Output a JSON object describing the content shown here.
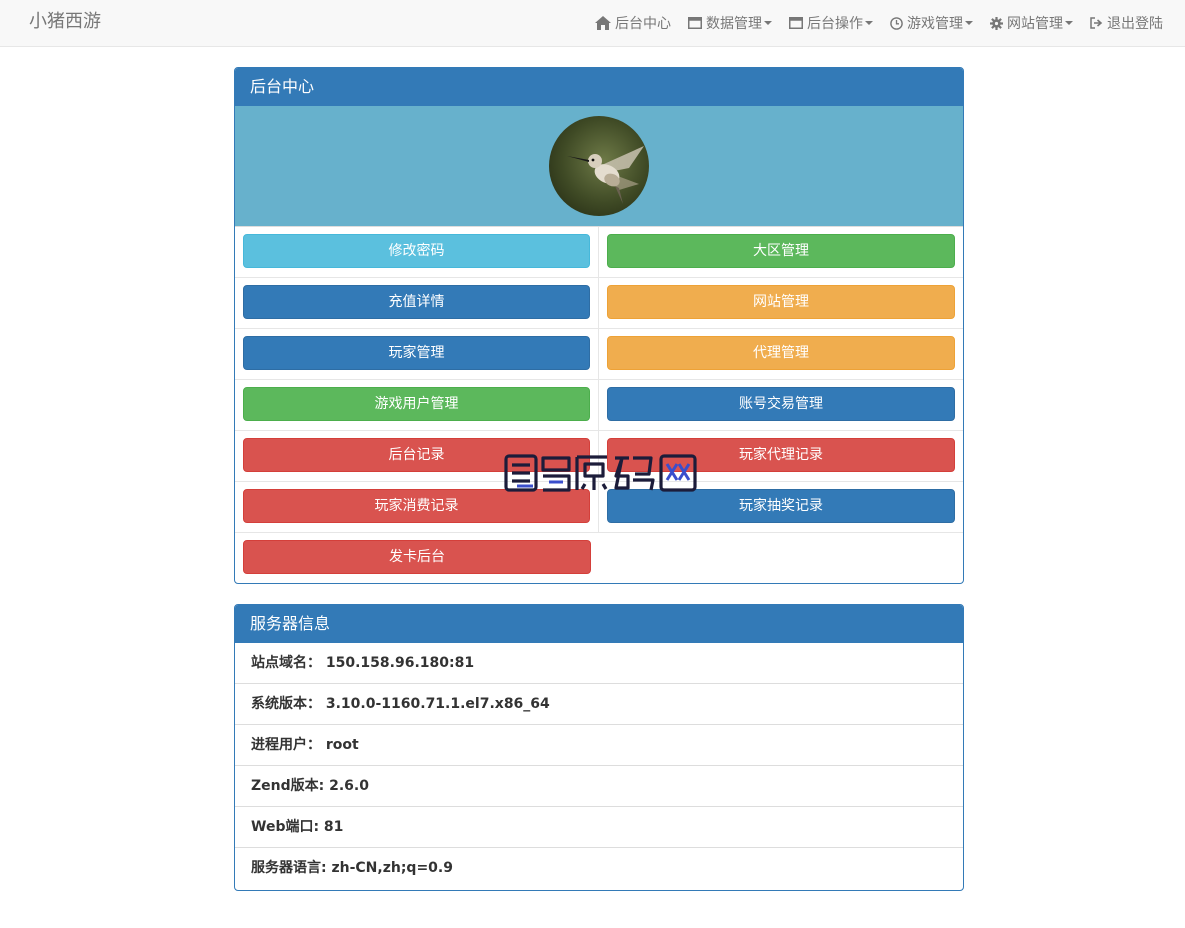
{
  "navbar": {
    "brand": "小猪西游",
    "items": [
      {
        "label": "后台中心",
        "icon": "home-icon",
        "dropdown": false
      },
      {
        "label": "数据管理",
        "icon": "window-icon",
        "dropdown": true
      },
      {
        "label": "后台操作",
        "icon": "window-icon",
        "dropdown": true
      },
      {
        "label": "游戏管理",
        "icon": "clock-icon",
        "dropdown": true
      },
      {
        "label": "网站管理",
        "icon": "gear-icon",
        "dropdown": true
      },
      {
        "label": "退出登陆",
        "icon": "logout-icon",
        "dropdown": false
      }
    ]
  },
  "admin_panel": {
    "title": "后台中心",
    "avatar_icon": "hummingbird-avatar",
    "buttons": [
      {
        "label": "修改密码",
        "style": "info"
      },
      {
        "label": "大区管理",
        "style": "success"
      },
      {
        "label": "充值详情",
        "style": "primary"
      },
      {
        "label": "网站管理",
        "style": "warning"
      },
      {
        "label": "玩家管理",
        "style": "primary"
      },
      {
        "label": "代理管理",
        "style": "warning"
      },
      {
        "label": "游戏用户管理",
        "style": "success"
      },
      {
        "label": "账号交易管理",
        "style": "primary"
      },
      {
        "label": "后台记录",
        "style": "danger"
      },
      {
        "label": "玩家代理记录",
        "style": "danger"
      },
      {
        "label": "玩家消费记录",
        "style": "danger"
      },
      {
        "label": "玩家抽奖记录",
        "style": "primary"
      },
      {
        "label": "发卡后台",
        "style": "danger"
      }
    ]
  },
  "server_panel": {
    "title": "服务器信息",
    "rows": [
      "站点域名： 150.158.96.180:81",
      "系统版本： 3.10.0-1160.71.1.el7.x86_64",
      "进程用户： root",
      "Zend版本: 2.6.0",
      "Web端口: 81",
      "服务器语言: zh-CN,zh;q=0.9"
    ]
  },
  "watermark": "图六源码网",
  "colors": {
    "primary": "#337ab7",
    "info": "#5bc0de",
    "success": "#5cb85c",
    "warning": "#f0ad4e",
    "danger": "#d9534f",
    "hero": "#67b1cc"
  }
}
